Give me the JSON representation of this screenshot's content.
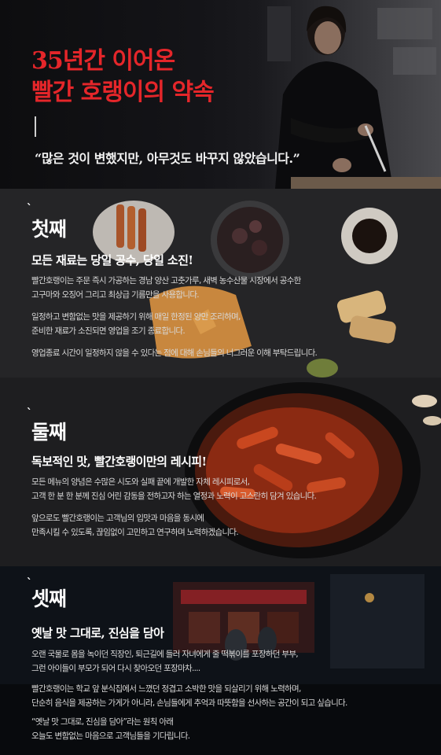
{
  "hero": {
    "title_line1": "35년간 이어온",
    "title_line2": "빨간 호랭이의 약속",
    "quote": "“많은 것이 변했지만, 아무것도 바꾸지 않았습니다.”",
    "colors": {
      "accent": "#e5262a",
      "background": "#141418"
    }
  },
  "sections": [
    {
      "heading": "첫째",
      "subheading": "모든 재료는 당일 공수, 당일 소진!",
      "paragraphs": [
        [
          "빨간호랭이는 주문 즉시 가공하는 경남 양산 고춧가루, 새벽 농수산물 시장에서 공수한",
          "고구마와 오징어 그리고 최상급 기름만을 사용합니다."
        ],
        [
          "일정하고 변함없는 맛을 제공하기 위해 매일 한정된 양만 조리하며,",
          "준비한 재료가 소진되면 영업을 조기 종료합니다."
        ],
        [
          "영업종료 시간이 일정하지 않을 수 있다는 점에 대해 손님들의 너그러운 이해 부탁드립니다."
        ]
      ]
    },
    {
      "heading": "둘째",
      "subheading": "독보적인 맛, 빨간호랭이만의 레시피!",
      "paragraphs": [
        [
          "모든 메뉴의 양념은 수많은 시도와 실패 끝에 개발한 자체 레시피로서,",
          "고객 한 분 한 분께 진심 어린 감동을 전하고자 하는 열정과 노력이 고스란히 담겨 있습니다."
        ],
        [
          "앞으로도 빨간호랭이는 고객님의 입맛과 마음을 동시에",
          "만족시킬 수 있도록, 끊임없이 고민하고 연구하며 노력하겠습니다."
        ]
      ]
    },
    {
      "heading": "셋째",
      "subheading": "옛날 맛 그대로, 진심을 담아",
      "paragraphs": [
        [
          "오랜 국물로 몸을 녹이던 직장인, 퇴근길에 들러 자녀에게 줄 떡볶이를 포장하던 부부,",
          "그런 아이들이 부모가 되어 다시 찾아오던 포장마차...."
        ],
        [
          "빨간호랭이는 학교 앞 분식집에서 느꼈던 정겹고 소박한 맛을 되살리기 위해 노력하며,",
          "단순히 음식을 제공하는 가게가 아니라, 손님들에게 추억과 따뜻함을 선사하는 공간이 되고 싶습니다."
        ],
        [
          "“옛날 맛 그대로, 진심을 담아”라는 원칙 아래",
          "오늘도 변함없는 마음으로 고객님들을 기다립니다."
        ]
      ]
    }
  ]
}
